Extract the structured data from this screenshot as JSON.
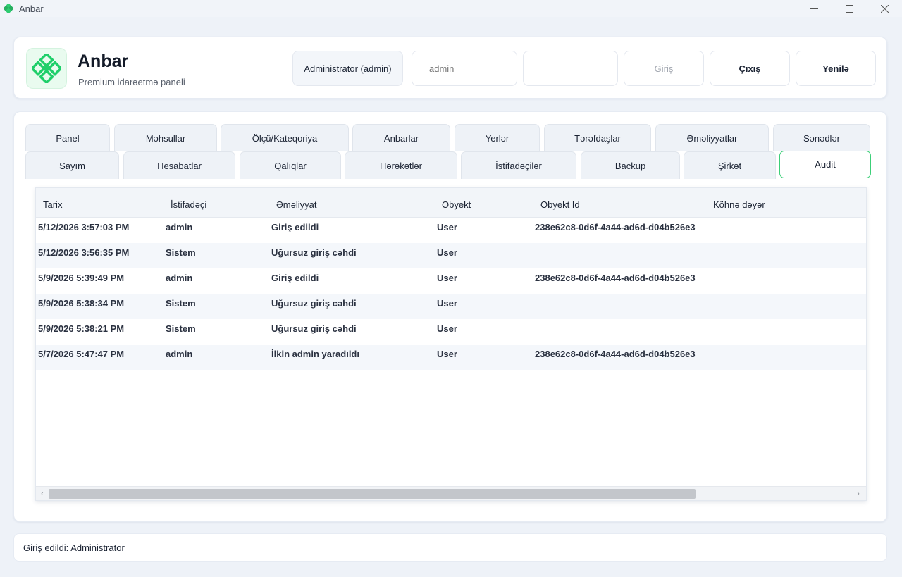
{
  "window": {
    "title": "Anbar",
    "app_icon": "diamond-logo-icon",
    "brand_color": "#2ecc71"
  },
  "header": {
    "brand_title": "Anbar",
    "brand_subtitle": "Premium idarəetmə paneli",
    "role_label": "Administrator (admin)",
    "username_placeholder": "admin",
    "password_value": "",
    "login_label": "Giriş",
    "logout_label": "Çıxış",
    "refresh_label": "Yenilə"
  },
  "tabs": {
    "row1": [
      "Panel",
      "Məhsullar",
      "Ölçü/Kateqoriya",
      "Anbarlar",
      "Yerlər",
      "Tərəfdaşlar",
      "Əməliyyatlar",
      "Sənədlər"
    ],
    "row2": [
      "Sayım",
      "Hesabatlar",
      "Qalıqlar",
      "Hərəkətlər",
      "İstifadəçilər",
      "Backup",
      "Şirkət",
      "Audit"
    ],
    "active": "Audit"
  },
  "grid": {
    "columns": [
      "Tarix",
      "İstifadəçi",
      "Əməliyyat",
      "Obyekt",
      "Obyekt Id",
      "Köhnə dəyər"
    ],
    "rows": [
      [
        "5/12/2026 3:57:03 PM",
        "admin",
        "Giriş edildi",
        "User",
        "238e62c8-0d6f-4a44-ad6d-d04b526e3",
        ""
      ],
      [
        "5/12/2026 3:56:35 PM",
        "Sistem",
        "Uğursuz giriş cəhdi",
        "User",
        "",
        ""
      ],
      [
        "5/9/2026 5:39:49 PM",
        "admin",
        "Giriş edildi",
        "User",
        "238e62c8-0d6f-4a44-ad6d-d04b526e3",
        ""
      ],
      [
        "5/9/2026 5:38:34 PM",
        "Sistem",
        "Uğursuz giriş cəhdi",
        "User",
        "",
        ""
      ],
      [
        "5/9/2026 5:38:21 PM",
        "Sistem",
        "Uğursuz giriş cəhdi",
        "User",
        "",
        ""
      ],
      [
        "5/7/2026 5:47:47 PM",
        "admin",
        "İlkin admin yaradıldı",
        "User",
        "238e62c8-0d6f-4a44-ad6d-d04b526e3",
        ""
      ]
    ]
  },
  "status": {
    "text": "Giriş edildi: Administrator"
  }
}
